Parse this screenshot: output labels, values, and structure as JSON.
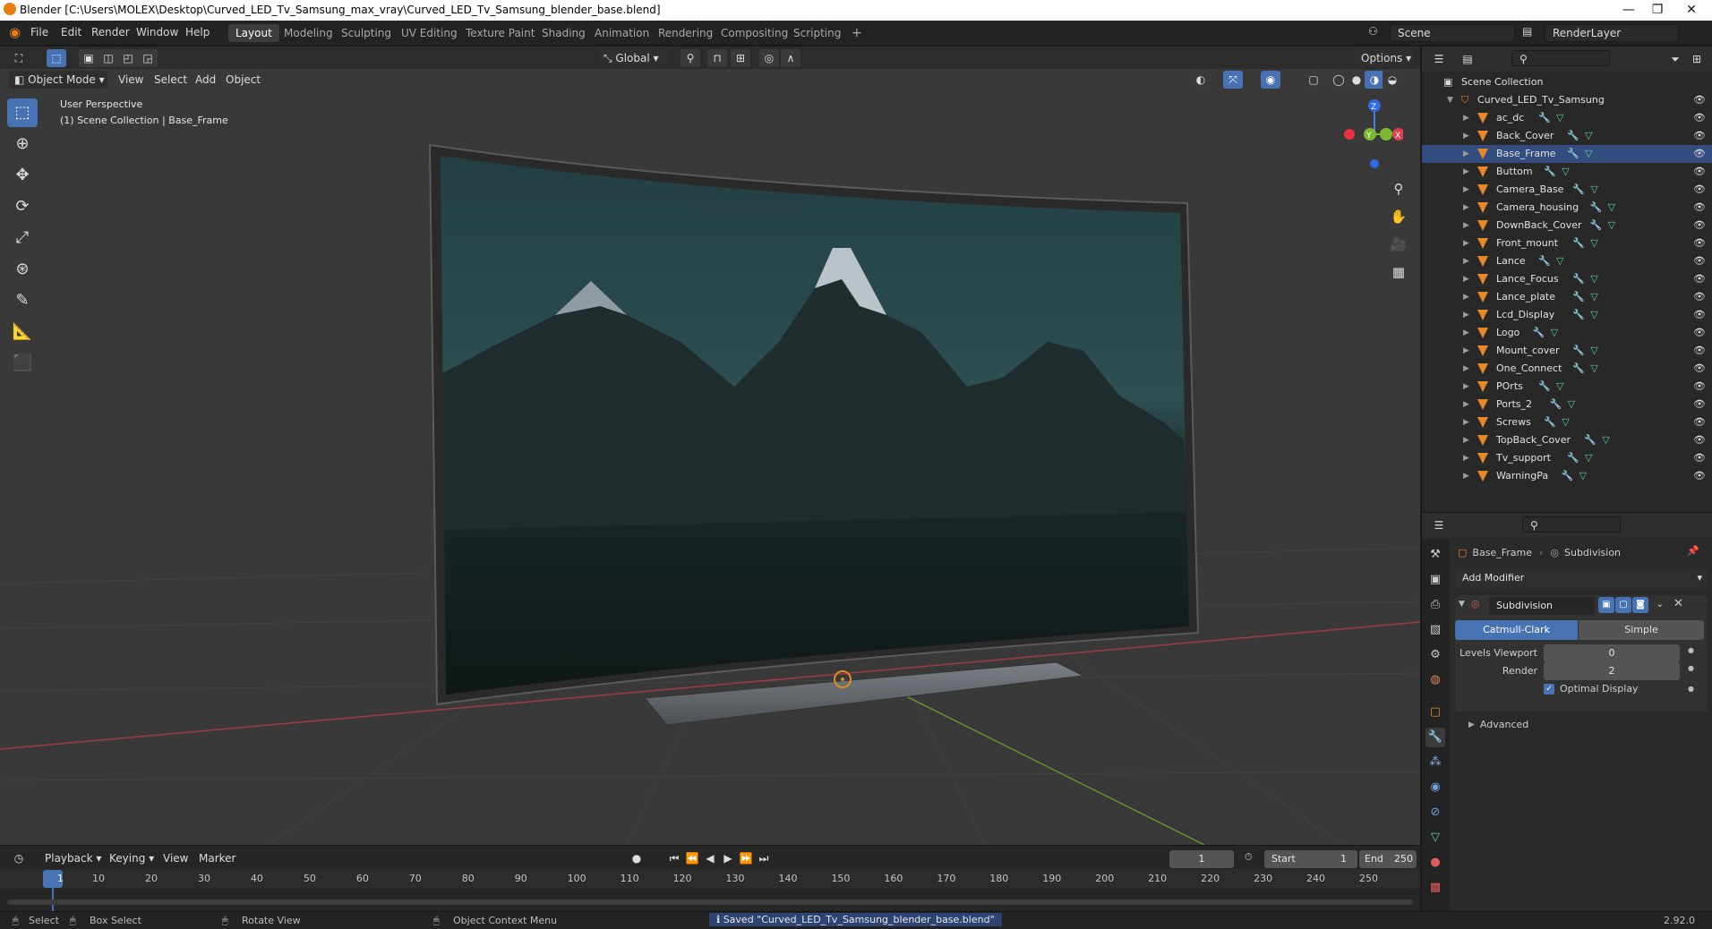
{
  "window": {
    "title": "Blender [C:\\Users\\MOLEX\\Desktop\\Curved_LED_Tv_Samsung_max_vray\\Curved_LED_Tv_Samsung_blender_base.blend]",
    "minimize": "—",
    "restore": "❐",
    "close": "✕"
  },
  "menu": {
    "items": [
      "File",
      "Edit",
      "Render",
      "Window",
      "Help"
    ],
    "workspaces": [
      "Layout",
      "Modeling",
      "Sculpting",
      "UV Editing",
      "Texture Paint",
      "Shading",
      "Animation",
      "Rendering",
      "Compositing",
      "Scripting",
      "+"
    ],
    "active_workspace": "Layout",
    "scene": "Scene",
    "view_layer": "RenderLayer"
  },
  "viewport": {
    "mode": "Object Mode",
    "menus": [
      "View",
      "Select",
      "Add",
      "Object"
    ],
    "transform_orientation": "Global",
    "options_label": "Options",
    "overlay_line1": "User Perspective",
    "overlay_line2": "(1) Scene Collection | Base_Frame",
    "gizmo": {
      "z": "Z",
      "y": "Y",
      "x": "X"
    }
  },
  "outliner": {
    "root": "Scene Collection",
    "collection": "Curved_LED_Tv_Samsung",
    "selected": "Base_Frame",
    "objects": [
      "ac_dc",
      "Back_Cover",
      "Base_Frame",
      "Buttom",
      "Camera_Base",
      "Camera_housing",
      "DownBack_Cover",
      "Front_mount",
      "Lance",
      "Lance_Focus",
      "Lance_plate",
      "Lcd_Display",
      "Logo",
      "Mount_cover",
      "One_Connect",
      "POrts",
      "Ports_2",
      "Screws",
      "TopBack_Cover",
      "Tv_support",
      "WarningPa"
    ]
  },
  "properties": {
    "object": "Base_Frame",
    "modifier_context": "Subdivision",
    "add_modifier": "Add Modifier",
    "modifier_name": "Subdivision",
    "type_catmull": "Catmull-Clark",
    "type_simple": "Simple",
    "levels_viewport_label": "Levels Viewport",
    "levels_viewport": "0",
    "render_label": "Render",
    "render": "2",
    "optimal_display": "Optimal Display",
    "advanced": "Advanced"
  },
  "timeline": {
    "menus": [
      "Playback",
      "Keying",
      "View",
      "Marker"
    ],
    "current_frame": "1",
    "start_label": "Start",
    "start": "1",
    "end_label": "End",
    "end": "250",
    "ticks": [
      "1",
      "10",
      "20",
      "30",
      "40",
      "50",
      "60",
      "70",
      "80",
      "90",
      "100",
      "110",
      "120",
      "130",
      "140",
      "150",
      "160",
      "170",
      "180",
      "190",
      "200",
      "210",
      "220",
      "230",
      "240",
      "250"
    ]
  },
  "status": {
    "select": "Select",
    "box_select": "Box Select",
    "rotate_view": "Rotate View",
    "context_menu": "Object Context Menu",
    "message": "Saved \"Curved_LED_Tv_Samsung_blender_base.blend\"",
    "version": "2.92.0"
  }
}
